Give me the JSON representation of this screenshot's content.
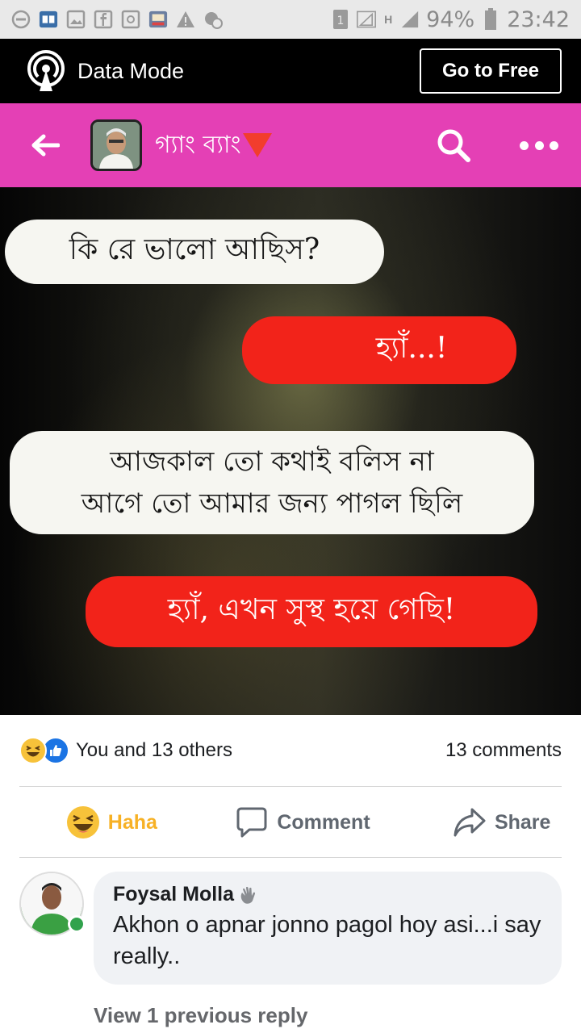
{
  "status_bar": {
    "battery_percent": "94%",
    "time": "23:42",
    "network_label": "H",
    "sim_label": "1",
    "icons": [
      "do-not-disturb-icon",
      "book-app-icon",
      "image-icon",
      "facebook-icon",
      "email-icon",
      "book-app-icon-2",
      "warning-icon",
      "settings-badge-icon"
    ]
  },
  "data_bar": {
    "label": "Data Mode",
    "go_free_label": "Go to Free"
  },
  "header": {
    "group_title": "গ্যাং ব্যাং",
    "accent_color": "#e440b5"
  },
  "post": {
    "messages": [
      {
        "text": "কি রে ভালো আছিস?",
        "style": "white"
      },
      {
        "text": "হ্যাঁ...!",
        "style": "red"
      },
      {
        "line1": "আজকাল তো কথাই বলিস না",
        "line2": "আগে তো আমার জন্য পাগল ছিলি",
        "style": "white"
      },
      {
        "text": "হ্যাঁ, এখন সুস্থ হয়ে গেছি!",
        "style": "red"
      }
    ]
  },
  "reactions": {
    "summary": "You and 13 others",
    "comment_count": "13 comments"
  },
  "actions": {
    "haha_label": "Haha",
    "comment_label": "Comment",
    "share_label": "Share"
  },
  "comment": {
    "author": "Foysal Molla",
    "text": "Akhon o apnar jonno pagol hoy asi...i say really..",
    "view_replies": "View 1 previous reply"
  }
}
